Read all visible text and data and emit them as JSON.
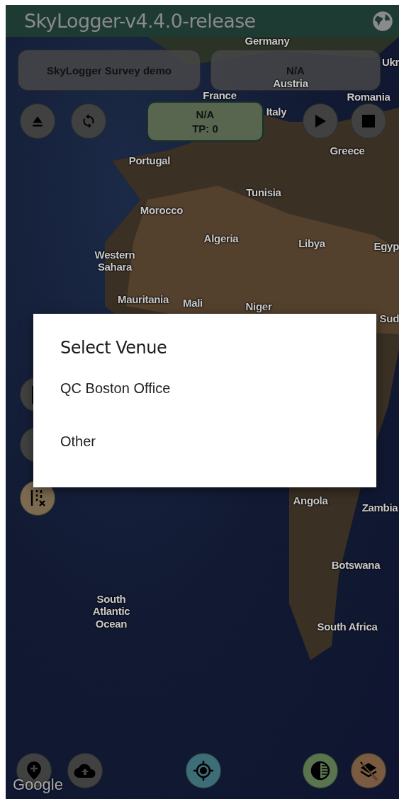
{
  "app_bar": {
    "title": "SkyLogger-v4.4.0-release"
  },
  "map": {
    "labels": [
      "Germany",
      "Ukr",
      "Austria",
      "France",
      "Romania",
      "Italy",
      "Greece",
      "Portugal",
      "Tunisia",
      "Morocco",
      "Algeria",
      "Libya",
      "Egyp",
      "Western\nSahara",
      "Mauritania",
      "Mali",
      "Niger",
      "Sud",
      "Angola",
      "Zambia",
      "Botswana",
      "South\nAtlantic\nOcean",
      "South Africa"
    ],
    "attribution": "Google"
  },
  "survey_button": {
    "label": "SkyLogger Survey demo"
  },
  "venue_button": {
    "label": "N/A"
  },
  "status": {
    "lines": [
      "N/A",
      "TP: 0"
    ]
  },
  "dialog": {
    "title": "Select Venue",
    "options": [
      {
        "label": "QC Boston Office"
      },
      {
        "label": "Other"
      }
    ]
  }
}
